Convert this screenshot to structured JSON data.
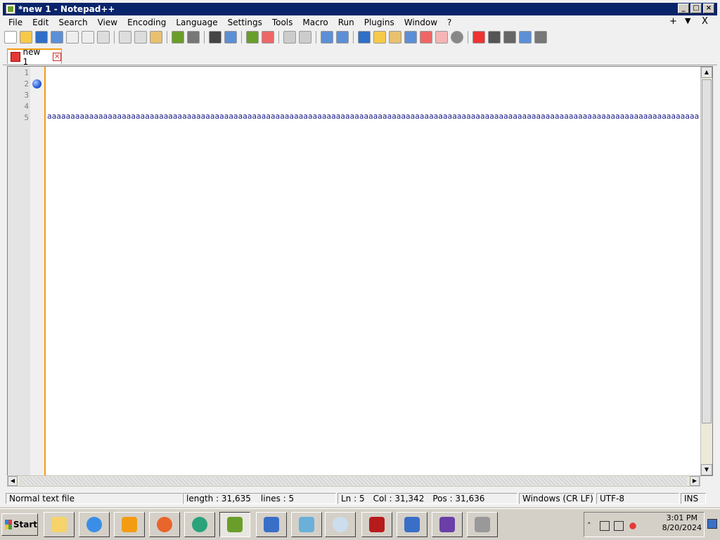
{
  "window": {
    "title": "*new 1 - Notepad++"
  },
  "menu": [
    "File",
    "Edit",
    "Search",
    "View",
    "Encoding",
    "Language",
    "Settings",
    "Tools",
    "Macro",
    "Run",
    "Plugins",
    "Window",
    "?"
  ],
  "menu_right": {
    "add": "+",
    "dropdown": "▼",
    "close": "X"
  },
  "tab": {
    "label": "new 1"
  },
  "editor": {
    "line_numbers": [
      "1",
      "2",
      "3",
      "4",
      "5"
    ],
    "line5": "aaaaaaaaaaaaaaaaaaaaaaaaaaaaaaaaaaaaaaaaaaaaaaaaaaaaaaaaaaaaaaaaaaaaaaaaaaaaaaaaaaaaaaaaaaaaaaaaaaaaaaaaaaaaaaaaaaaaaaaaaaaaaaaaaaaaaaaaaaaaaaaaaaaaaaaaaaaaaaaaaaaaaaa"
  },
  "status": {
    "file_type": "Normal text file",
    "length": "length : 31,635",
    "lines": "lines : 5",
    "ln": "Ln : 5",
    "col": "Col : 31,342",
    "pos": "Pos : 31,636",
    "eol": "Windows (CR LF)",
    "encoding": "UTF-8",
    "mode": "INS"
  },
  "taskbar": {
    "start_label": "Start",
    "time": "3:01 PM",
    "date": "8/20/2024"
  }
}
